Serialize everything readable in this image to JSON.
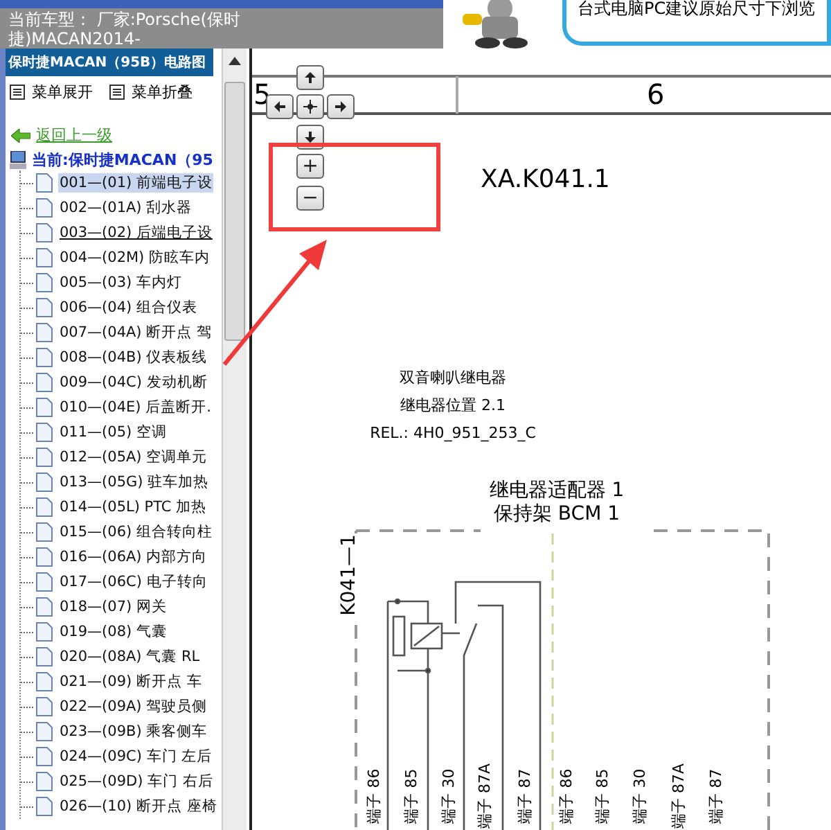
{
  "header": {
    "vehicle_label": "当前车型：",
    "manufacturer_line1": "厂家:Porsche(保时",
    "manufacturer_line2": "捷)MACAN2014-"
  },
  "banner": {
    "message": "台式电脑PC建议原始尺寸下浏览"
  },
  "sidebar": {
    "title": "保时捷MACAN（95B）电路图",
    "menu": [
      {
        "label": "菜单展开"
      },
      {
        "label": "菜单折叠"
      }
    ],
    "back_link": "返回上一级",
    "current": "当前:保时捷MACAN（95",
    "items": [
      {
        "label": "001—(01) 前端电子设",
        "selected": true,
        "hovered": false
      },
      {
        "label": "002—(01A) 刮水器",
        "selected": false,
        "hovered": false
      },
      {
        "label": "003—(02) 后端电子设",
        "selected": false,
        "hovered": true
      },
      {
        "label": "004—(02M) 防眩车内",
        "selected": false,
        "hovered": false
      },
      {
        "label": "005—(03) 车内灯",
        "selected": false,
        "hovered": false
      },
      {
        "label": "006—(04) 组合仪表",
        "selected": false,
        "hovered": false
      },
      {
        "label": "007—(04A) 断开点 驾",
        "selected": false,
        "hovered": false
      },
      {
        "label": "008—(04B) 仪表板线",
        "selected": false,
        "hovered": false
      },
      {
        "label": "009—(04C) 发动机断",
        "selected": false,
        "hovered": false
      },
      {
        "label": "010—(04E) 后盖断开.",
        "selected": false,
        "hovered": false
      },
      {
        "label": "011—(05) 空调",
        "selected": false,
        "hovered": false
      },
      {
        "label": "012—(05A) 空调单元",
        "selected": false,
        "hovered": false
      },
      {
        "label": "013—(05G) 驻车加热",
        "selected": false,
        "hovered": false
      },
      {
        "label": "014—(05L) PTC 加热",
        "selected": false,
        "hovered": false
      },
      {
        "label": "015—(06) 组合转向柱",
        "selected": false,
        "hovered": false
      },
      {
        "label": "016—(06A) 内部方向",
        "selected": false,
        "hovered": false
      },
      {
        "label": "017—(06C) 电子转向",
        "selected": false,
        "hovered": false
      },
      {
        "label": "018—(07) 网关",
        "selected": false,
        "hovered": false
      },
      {
        "label": "019—(08) 气囊",
        "selected": false,
        "hovered": false
      },
      {
        "label": "020—(08A) 气囊 RL",
        "selected": false,
        "hovered": false
      },
      {
        "label": "021—(09) 断开点 车",
        "selected": false,
        "hovered": false
      },
      {
        "label": "022—(09A) 驾驶员侧",
        "selected": false,
        "hovered": false
      },
      {
        "label": "023—(09B) 乘客侧车",
        "selected": false,
        "hovered": false
      },
      {
        "label": "024—(09C) 车门 左后",
        "selected": false,
        "hovered": false
      },
      {
        "label": "025—(09D) 车门 右后",
        "selected": false,
        "hovered": false
      },
      {
        "label": "026—(10) 断开点 座椅",
        "selected": false,
        "hovered": false
      }
    ]
  },
  "diagram": {
    "columns": [
      "5",
      "6"
    ],
    "zoom_in": "+",
    "zoom_out": "−",
    "component_id": "XA.K041.1",
    "relay_labels": [
      "双音喇叭继电器",
      "继电器位置 2.1",
      "REL.: 4H0_951_253_C"
    ],
    "adapter_labels": [
      "继电器适配器 1",
      "保持架 BCM 1"
    ],
    "connector": "K041—1",
    "terminals": [
      "端子 86",
      "端子 85",
      "端子 30",
      "端子 87A",
      "端子 87",
      "端子 86",
      "端子 85",
      "端子 30",
      "端子 87A",
      "端子 87"
    ]
  }
}
